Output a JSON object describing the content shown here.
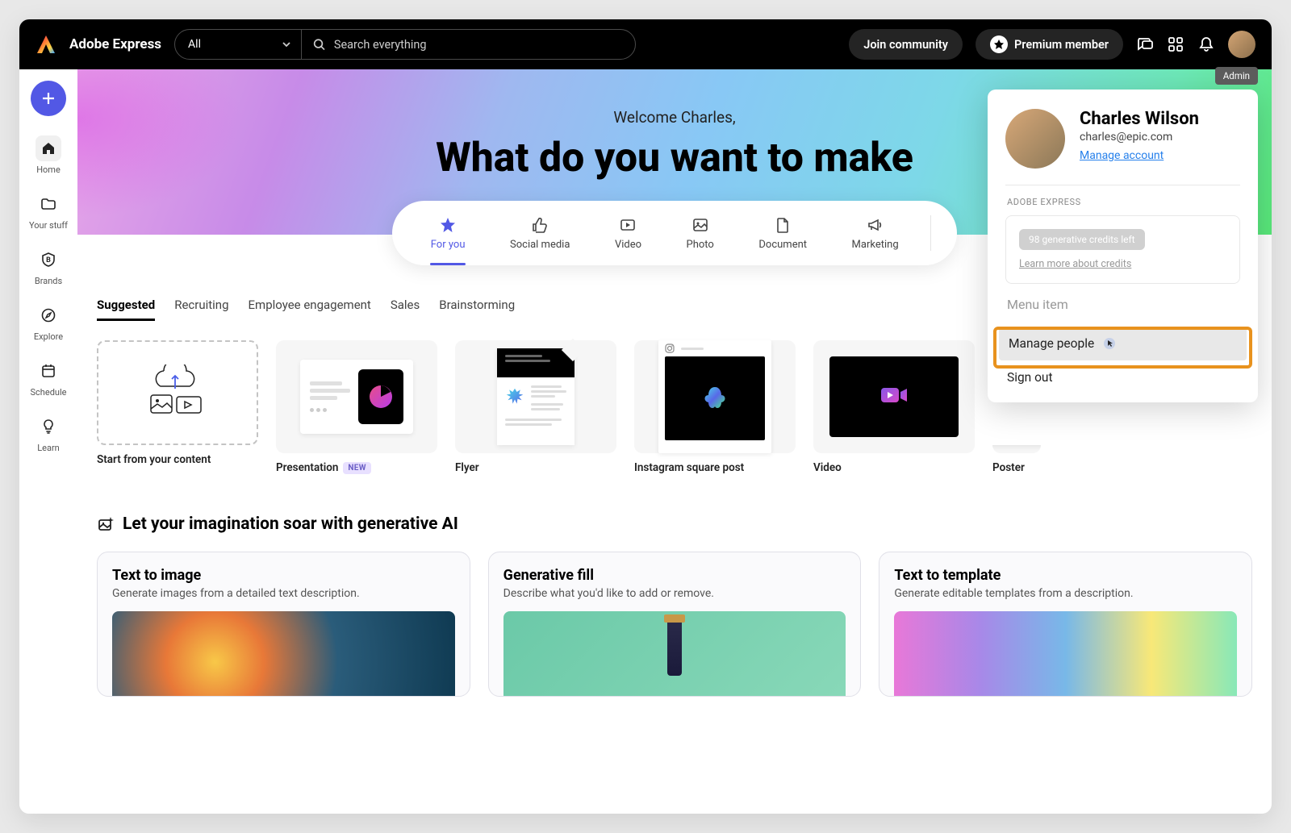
{
  "header": {
    "brand": "Adobe Express",
    "filter": "All",
    "search_placeholder": "Search everything",
    "join_community": "Join community",
    "premium": "Premium member"
  },
  "sidebar": {
    "items": [
      {
        "label": "Home"
      },
      {
        "label": "Your stuff"
      },
      {
        "label": "Brands"
      },
      {
        "label": "Explore"
      },
      {
        "label": "Schedule"
      },
      {
        "label": "Learn"
      }
    ]
  },
  "hero": {
    "welcome": "Welcome Charles,",
    "title": "What do you want to make"
  },
  "categories": [
    {
      "label": "For you"
    },
    {
      "label": "Social media"
    },
    {
      "label": "Video"
    },
    {
      "label": "Photo"
    },
    {
      "label": "Document"
    },
    {
      "label": "Marketing"
    }
  ],
  "filter_tabs": [
    {
      "label": "Suggested"
    },
    {
      "label": "Recruiting"
    },
    {
      "label": "Employee engagement"
    },
    {
      "label": "Sales"
    },
    {
      "label": "Brainstorming"
    }
  ],
  "templates": [
    {
      "caption": "Start from your content"
    },
    {
      "caption": "Presentation",
      "new": "NEW"
    },
    {
      "caption": "Flyer"
    },
    {
      "caption": "Instagram square post"
    },
    {
      "caption": "Video"
    },
    {
      "caption": "Poster"
    }
  ],
  "ai": {
    "heading": "Let your imagination soar with generative AI",
    "cards": [
      {
        "title": "Text to image",
        "sub": "Generate images from a detailed text description."
      },
      {
        "title": "Generative fill",
        "sub": "Describe what you'd like to add or remove."
      },
      {
        "title": "Text to template",
        "sub": "Generate editable templates from a description."
      }
    ]
  },
  "profile": {
    "admin_tag": "Admin",
    "name": "Charles Wilson",
    "email": "charles@epic.com",
    "manage_link": "Manage account",
    "section": "ADOBE EXPRESS",
    "credits_chip": "98 generative credits left",
    "credits_link": "Learn more about credits",
    "menu_placeholder": "Menu item",
    "manage_people": "Manage people",
    "sign_out": "Sign out"
  }
}
